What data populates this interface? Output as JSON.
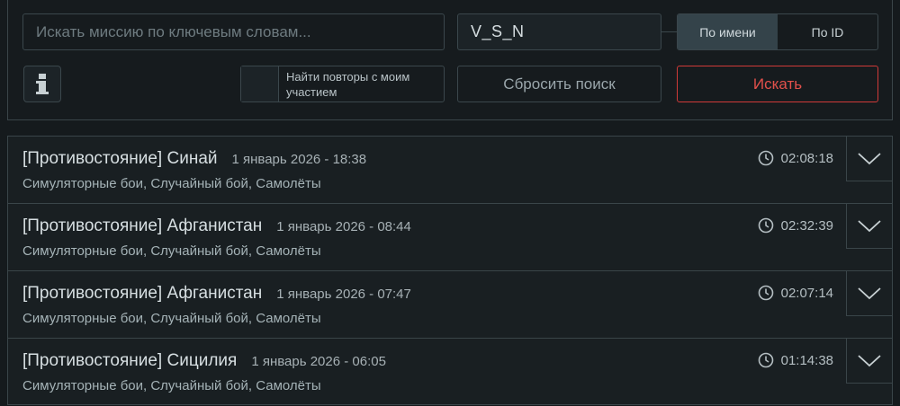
{
  "search": {
    "placeholder": "Искать миссию по ключевым словам...",
    "value": ""
  },
  "user_filter": {
    "value": "V_S_N"
  },
  "mode_toggle": {
    "by_name": "По имени",
    "by_id": "По ID",
    "selected": "by_name"
  },
  "my_replays_checkbox": {
    "label": "Найти повторы с моим участием",
    "checked": false
  },
  "buttons": {
    "reset": "Сбросить поиск",
    "search": "Искать"
  },
  "colors": {
    "accent_red": "#d03a38",
    "border": "#3b474c",
    "background": "#151a1d"
  },
  "icons": {
    "info": "info-icon",
    "clock": "clock-icon",
    "expand": "chevron-down-icon"
  },
  "missions": [
    {
      "name": "[Противостояние] Синай",
      "date": "1 январь 2026 - 18:38",
      "duration": "02:08:18",
      "tags": "Симуляторные бои, Случайный бой, Самолёты"
    },
    {
      "name": "[Противостояние] Афганистан",
      "date": "1 январь 2026 - 08:44",
      "duration": "02:32:39",
      "tags": "Симуляторные бои, Случайный бой, Самолёты"
    },
    {
      "name": "[Противостояние] Афганистан",
      "date": "1 январь 2026 - 07:47",
      "duration": "02:07:14",
      "tags": "Симуляторные бои, Случайный бой, Самолёты"
    },
    {
      "name": "[Противостояние] Сицилия",
      "date": "1 январь 2026 - 06:05",
      "duration": "01:14:38",
      "tags": "Симуляторные бои, Случайный бой, Самолёты"
    }
  ]
}
